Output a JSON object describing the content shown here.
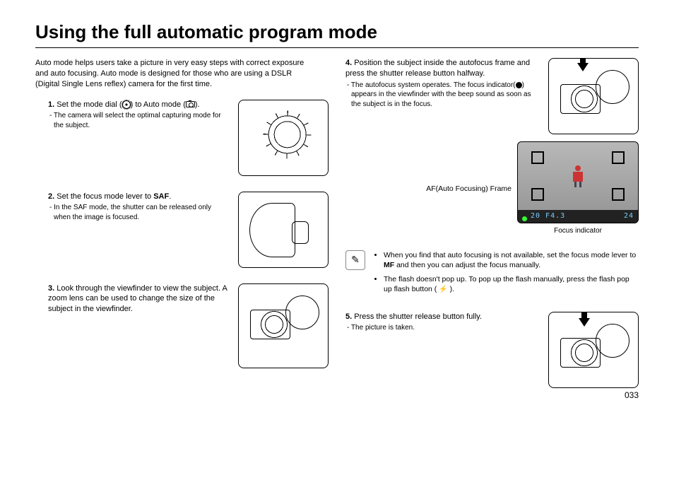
{
  "title": "Using the full automatic program mode",
  "intro": "Auto mode helps users take a picture in very easy steps with correct exposure and auto focusing. Auto mode is designed for those who are using a DSLR (Digital Single Lens reflex) camera for the first time.",
  "steps": {
    "s1": {
      "num": "1.",
      "text_a": "Set the mode dial (",
      "text_b": ") to Auto mode (",
      "text_c": ").",
      "sub": "- The camera will select the optimal capturing mode for the subject."
    },
    "s2": {
      "num": "2.",
      "text_a": "Set the focus mode lever to ",
      "saf": "SAF",
      "text_b": ".",
      "sub": "- In the SAF mode, the shutter can be released only when the image is focused."
    },
    "s3": {
      "num": "3.",
      "text": "Look through the viewfinder to view the subject. A zoom lens can be used to change the size of the subject in the viewfinder."
    },
    "s4": {
      "num": "4.",
      "text": "Position the subject inside the autofocus frame and press the shutter release button halfway.",
      "sub_a": "- The autofocus system operates. The focus indicator(",
      "sub_b": ") appears in the viewfinder with the beep sound as soon as the subject is in the focus."
    },
    "s5": {
      "num": "5.",
      "text": "Press the shutter release button fully.",
      "sub": "- The picture is taken."
    }
  },
  "af_frame_label": "AF(Auto Focusing) Frame",
  "focus_indicator_label": "Focus indicator",
  "lcd": {
    "left": "20 F4.3",
    "right": "24"
  },
  "notes": {
    "n1_a": "When you find that auto focusing is not available, set the focus mode lever to ",
    "n1_mf": "MF",
    "n1_b": " and then you can adjust the focus manually.",
    "n2_a": "The flash doesn't pop up. To pop up the flash manually, press the flash pop up flash button ( ",
    "n2_b": " )."
  },
  "page_number": "033"
}
